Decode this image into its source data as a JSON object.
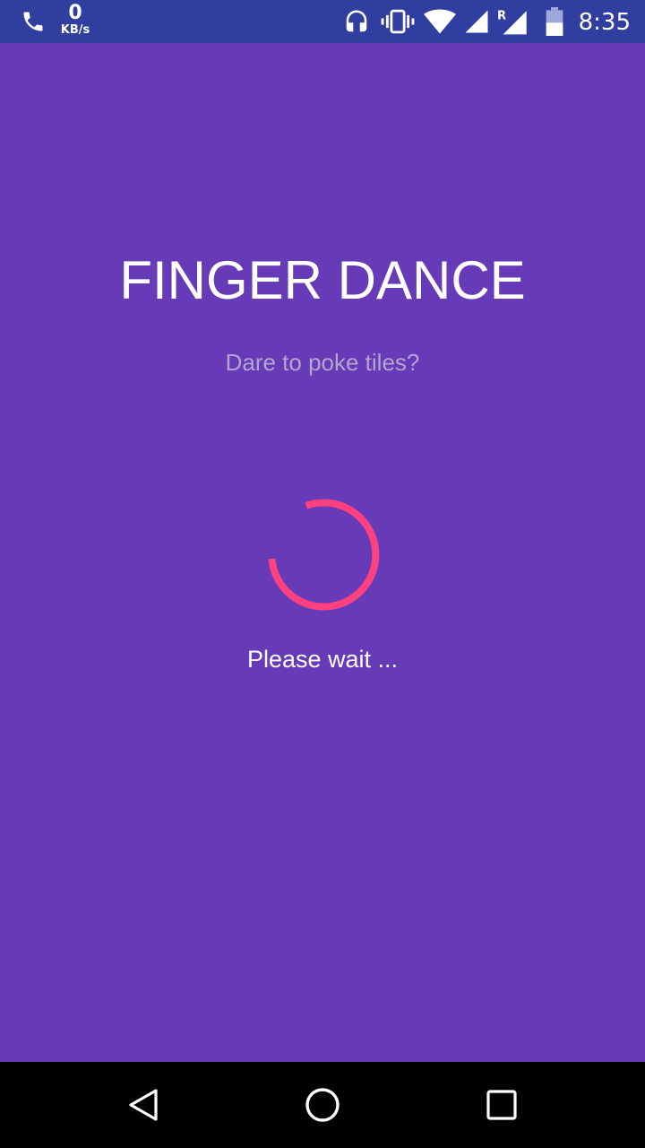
{
  "status_bar": {
    "speed_value": "0",
    "speed_unit": "KB/s",
    "time": "8:35",
    "icons": [
      "phone-icon",
      "headset-icon",
      "vibrate-icon",
      "wifi-icon",
      "signal-icon",
      "signal-roaming-icon",
      "battery-icon"
    ],
    "roaming_marker": "R"
  },
  "main": {
    "title": "FINGER DANCE",
    "subtitle": "Dare to poke tiles?",
    "loading_text": "Please wait ..."
  },
  "nav_bar": {
    "icons": [
      "back-icon",
      "home-icon",
      "recents-icon"
    ]
  },
  "colors": {
    "background": "#673AB7",
    "status_bar": "#303F9F",
    "subtitle": "#B3A5CF",
    "spinner": "#FF4081",
    "nav_bar": "#000000"
  }
}
